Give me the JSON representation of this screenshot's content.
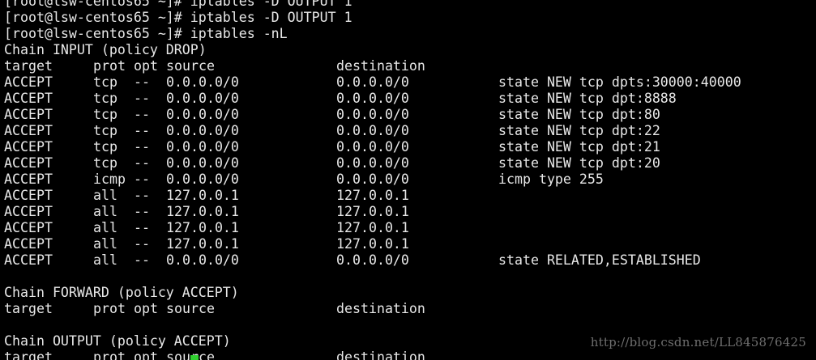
{
  "terminal": {
    "partial_prev_line": "[root@lsw-centos65 ~]# iptables -D OUTPUT 1",
    "prompt_line_1": "[root@lsw-centos65 ~]# iptables -D OUTPUT 1",
    "prompt_line_2": "[root@lsw-centos65 ~]# iptables -nL",
    "header": {
      "target": "target",
      "prot": "prot",
      "opt": "opt",
      "source": "source",
      "destination": "destination"
    },
    "chains": [
      {
        "title": "Chain INPUT (policy DROP)",
        "rules": [
          {
            "target": "ACCEPT",
            "prot": "tcp",
            "opt": "--",
            "source": "0.0.0.0/0",
            "destination": "0.0.0.0/0",
            "extra": "state NEW tcp dpts:30000:40000"
          },
          {
            "target": "ACCEPT",
            "prot": "tcp",
            "opt": "--",
            "source": "0.0.0.0/0",
            "destination": "0.0.0.0/0",
            "extra": "state NEW tcp dpt:8888"
          },
          {
            "target": "ACCEPT",
            "prot": "tcp",
            "opt": "--",
            "source": "0.0.0.0/0",
            "destination": "0.0.0.0/0",
            "extra": "state NEW tcp dpt:80"
          },
          {
            "target": "ACCEPT",
            "prot": "tcp",
            "opt": "--",
            "source": "0.0.0.0/0",
            "destination": "0.0.0.0/0",
            "extra": "state NEW tcp dpt:22"
          },
          {
            "target": "ACCEPT",
            "prot": "tcp",
            "opt": "--",
            "source": "0.0.0.0/0",
            "destination": "0.0.0.0/0",
            "extra": "state NEW tcp dpt:21"
          },
          {
            "target": "ACCEPT",
            "prot": "tcp",
            "opt": "--",
            "source": "0.0.0.0/0",
            "destination": "0.0.0.0/0",
            "extra": "state NEW tcp dpt:20"
          },
          {
            "target": "ACCEPT",
            "prot": "icmp",
            "opt": "--",
            "source": "0.0.0.0/0",
            "destination": "0.0.0.0/0",
            "extra": "icmp type 255"
          },
          {
            "target": "ACCEPT",
            "prot": "all",
            "opt": "--",
            "source": "127.0.0.1",
            "destination": "127.0.0.1",
            "extra": ""
          },
          {
            "target": "ACCEPT",
            "prot": "all",
            "opt": "--",
            "source": "127.0.0.1",
            "destination": "127.0.0.1",
            "extra": ""
          },
          {
            "target": "ACCEPT",
            "prot": "all",
            "opt": "--",
            "source": "127.0.0.1",
            "destination": "127.0.0.1",
            "extra": ""
          },
          {
            "target": "ACCEPT",
            "prot": "all",
            "opt": "--",
            "source": "127.0.0.1",
            "destination": "127.0.0.1",
            "extra": ""
          },
          {
            "target": "ACCEPT",
            "prot": "all",
            "opt": "--",
            "source": "0.0.0.0/0",
            "destination": "0.0.0.0/0",
            "extra": "state RELATED,ESTABLISHED"
          }
        ]
      },
      {
        "title": "Chain FORWARD (policy ACCEPT)",
        "rules": []
      },
      {
        "title": "Chain OUTPUT (policy ACCEPT)",
        "rules": []
      }
    ]
  },
  "watermark": "http://blog.csdn.net/LL845876425",
  "colors": {
    "background": "#000000",
    "text": "#e8e8e8",
    "cursor": "#2fd02f",
    "watermark": "#6e6e6e"
  }
}
